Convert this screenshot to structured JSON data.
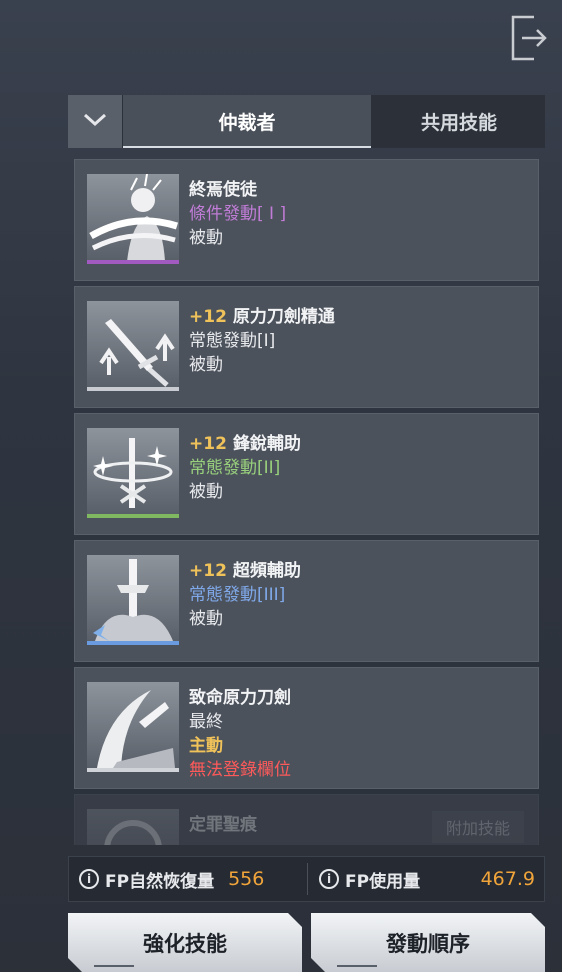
{
  "tabs": {
    "active": "仲裁者",
    "other": "共用技能"
  },
  "skills": [
    {
      "level": "",
      "name": "終焉使徒",
      "trigger": "條件發動[ I ]",
      "trigger_color": "#c07cd6",
      "kind": "被動",
      "extra": "",
      "extra2": "",
      "bar_color": "#a05ac0"
    },
    {
      "level": "+12",
      "name": "原力刀劍精通",
      "trigger": "常態發動[I]",
      "trigger_color": "#e7e9ec",
      "kind": "被動",
      "extra": "",
      "extra2": "",
      "bar_color": "#c8ccd2"
    },
    {
      "level": "+12",
      "name": "鋒銳輔助",
      "trigger": "常態發動[II]",
      "trigger_color": "#98cf7c",
      "kind": "被動",
      "extra": "",
      "extra2": "",
      "bar_color": "#7fb860"
    },
    {
      "level": "+12",
      "name": "超頻輔助",
      "trigger": "常態發動[III]",
      "trigger_color": "#7fa8e8",
      "kind": "被動",
      "extra": "",
      "extra2": "",
      "bar_color": "#6a9be0"
    },
    {
      "level": "",
      "name": "致命原力刀劍",
      "trigger": "最終",
      "trigger_color": "#e7e9ec",
      "kind": "主動",
      "kind_color": "#f0c25a",
      "extra": "無法登錄欄位",
      "extra_color": "#ff5a5a",
      "bar_color": "#d0d3d8"
    }
  ],
  "faded_skill": {
    "name": "定罪聖痕",
    "badge": "附加技能"
  },
  "footer": {
    "fp_recovery_label": "FP自然恢復量",
    "fp_recovery_value": "556",
    "fp_usage_label": "FP使用量",
    "fp_usage_value": "467.9"
  },
  "buttons": {
    "enhance": "強化技能",
    "order": "發動順序"
  },
  "icons": {
    "exit": "exit-icon",
    "dropdown": "chevron-down-icon",
    "info": "info-icon"
  }
}
